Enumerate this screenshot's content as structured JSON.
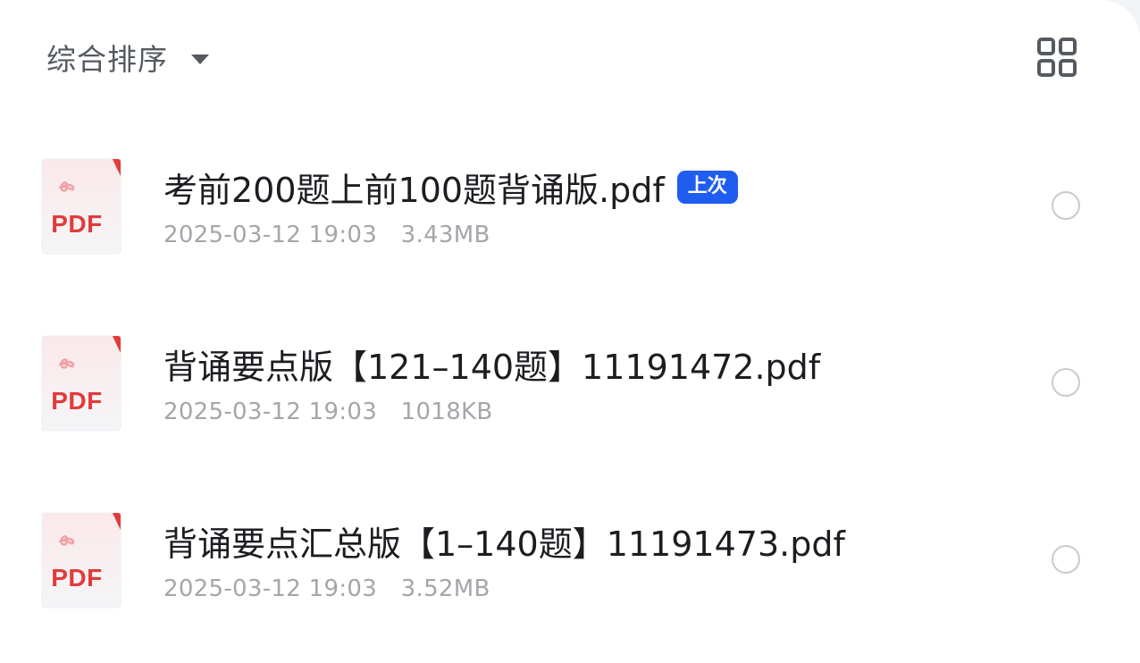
{
  "toolbar": {
    "sort_label": "综合排序",
    "sort_icon": "caret-down-icon",
    "view_toggle_icon": "grid-view-icon"
  },
  "files": [
    {
      "name": "考前200题上前100题背诵版.pdf",
      "badge": "上次",
      "date": "2025-03-12 19:03",
      "size": "3.43MB",
      "type_label": "PDF"
    },
    {
      "name": "背诵要点版【121–140题】11191472.pdf",
      "badge": "",
      "date": "2025-03-12 19:03",
      "size": "1018KB",
      "type_label": "PDF"
    },
    {
      "name": "背诵要点汇总版【1–140题】11191473.pdf",
      "badge": "",
      "date": "2025-03-12 19:03",
      "size": "3.52MB",
      "type_label": "PDF"
    }
  ],
  "colors": {
    "accent": "#1f5cf0",
    "pdf_red": "#e23b3b",
    "meta_gray": "#a3a6ab"
  }
}
